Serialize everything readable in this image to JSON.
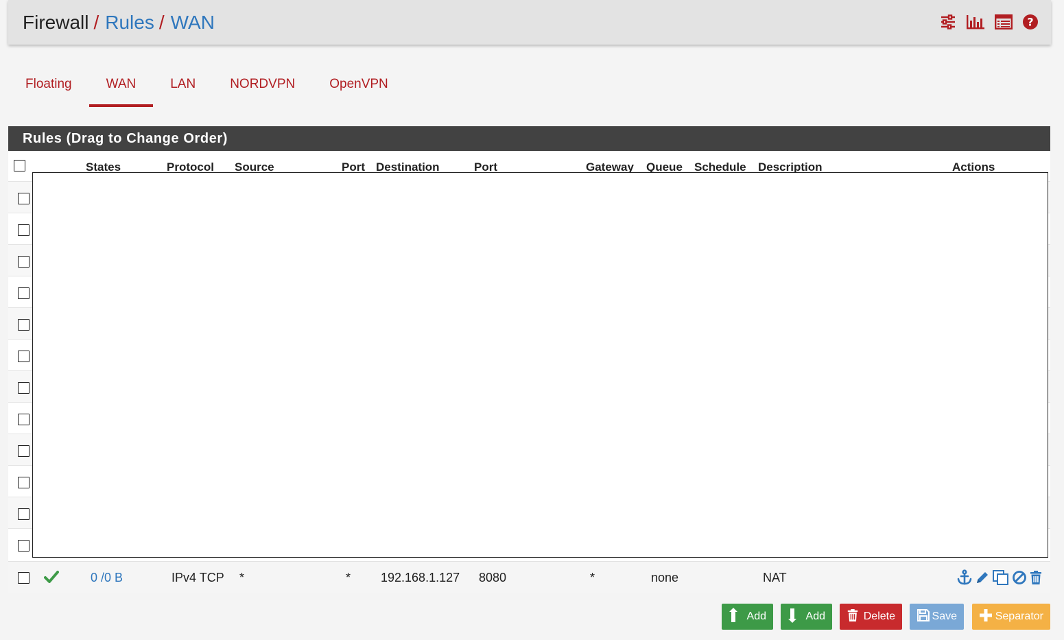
{
  "breadcrumb": {
    "root": "Firewall",
    "separator": "/",
    "rules": "Rules",
    "current": "WAN"
  },
  "header_icons": [
    "sliders-icon",
    "bar-chart-icon",
    "list-icon",
    "help-icon"
  ],
  "tabs": [
    {
      "label": "Floating",
      "active": false
    },
    {
      "label": "WAN",
      "active": true
    },
    {
      "label": "LAN",
      "active": false
    },
    {
      "label": "NORDVPN",
      "active": false
    },
    {
      "label": "OpenVPN",
      "active": false
    }
  ],
  "panel": {
    "title": "Rules (Drag to Change Order)"
  },
  "table": {
    "columns": {
      "states": "States",
      "protocol": "Protocol",
      "source": "Source",
      "port": "Port",
      "destination": "Destination",
      "dest_port": "Port",
      "gateway": "Gateway",
      "queue": "Queue",
      "schedule": "Schedule",
      "description": "Description",
      "actions": "Actions"
    },
    "rule": {
      "states": "0 /0 B",
      "protocol": "IPv4 TCP",
      "source": "*",
      "port": "*",
      "destination": "192.168.1.127",
      "dest_port": "8080",
      "gateway": "*",
      "queue": "none",
      "schedule": "",
      "description": "NAT"
    }
  },
  "buttons": {
    "add_top": "Add",
    "add_bottom": "Add",
    "delete": "Delete",
    "save": "Save",
    "separator": "Separator"
  },
  "colors": {
    "accent_red": "#b11e22",
    "link_blue": "#2f77bd",
    "panel_header": "#424242",
    "green": "#3d9a47",
    "orange": "#f4b145"
  }
}
